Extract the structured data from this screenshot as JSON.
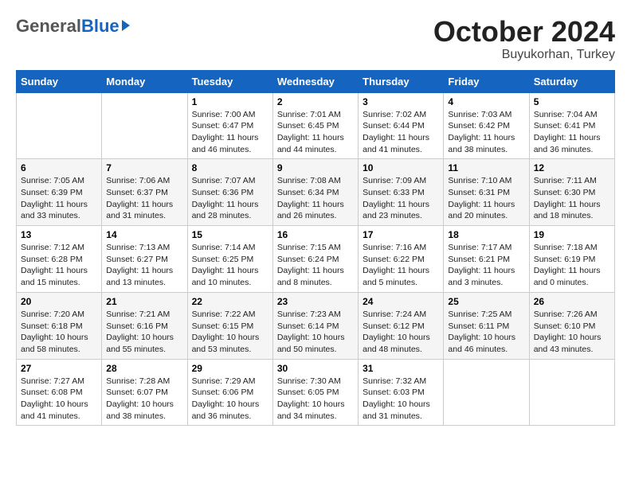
{
  "header": {
    "logo_general": "General",
    "logo_blue": "Blue",
    "month_title": "October 2024",
    "location": "Buyukorhan, Turkey"
  },
  "weekdays": [
    "Sunday",
    "Monday",
    "Tuesday",
    "Wednesday",
    "Thursday",
    "Friday",
    "Saturday"
  ],
  "weeks": [
    [
      null,
      null,
      {
        "day": 1,
        "sunrise": "7:00 AM",
        "sunset": "6:47 PM",
        "daylight": "11 hours and 46 minutes."
      },
      {
        "day": 2,
        "sunrise": "7:01 AM",
        "sunset": "6:45 PM",
        "daylight": "11 hours and 44 minutes."
      },
      {
        "day": 3,
        "sunrise": "7:02 AM",
        "sunset": "6:44 PM",
        "daylight": "11 hours and 41 minutes."
      },
      {
        "day": 4,
        "sunrise": "7:03 AM",
        "sunset": "6:42 PM",
        "daylight": "11 hours and 38 minutes."
      },
      {
        "day": 5,
        "sunrise": "7:04 AM",
        "sunset": "6:41 PM",
        "daylight": "11 hours and 36 minutes."
      }
    ],
    [
      {
        "day": 6,
        "sunrise": "7:05 AM",
        "sunset": "6:39 PM",
        "daylight": "11 hours and 33 minutes."
      },
      {
        "day": 7,
        "sunrise": "7:06 AM",
        "sunset": "6:37 PM",
        "daylight": "11 hours and 31 minutes."
      },
      {
        "day": 8,
        "sunrise": "7:07 AM",
        "sunset": "6:36 PM",
        "daylight": "11 hours and 28 minutes."
      },
      {
        "day": 9,
        "sunrise": "7:08 AM",
        "sunset": "6:34 PM",
        "daylight": "11 hours and 26 minutes."
      },
      {
        "day": 10,
        "sunrise": "7:09 AM",
        "sunset": "6:33 PM",
        "daylight": "11 hours and 23 minutes."
      },
      {
        "day": 11,
        "sunrise": "7:10 AM",
        "sunset": "6:31 PM",
        "daylight": "11 hours and 20 minutes."
      },
      {
        "day": 12,
        "sunrise": "7:11 AM",
        "sunset": "6:30 PM",
        "daylight": "11 hours and 18 minutes."
      }
    ],
    [
      {
        "day": 13,
        "sunrise": "7:12 AM",
        "sunset": "6:28 PM",
        "daylight": "11 hours and 15 minutes."
      },
      {
        "day": 14,
        "sunrise": "7:13 AM",
        "sunset": "6:27 PM",
        "daylight": "11 hours and 13 minutes."
      },
      {
        "day": 15,
        "sunrise": "7:14 AM",
        "sunset": "6:25 PM",
        "daylight": "11 hours and 10 minutes."
      },
      {
        "day": 16,
        "sunrise": "7:15 AM",
        "sunset": "6:24 PM",
        "daylight": "11 hours and 8 minutes."
      },
      {
        "day": 17,
        "sunrise": "7:16 AM",
        "sunset": "6:22 PM",
        "daylight": "11 hours and 5 minutes."
      },
      {
        "day": 18,
        "sunrise": "7:17 AM",
        "sunset": "6:21 PM",
        "daylight": "11 hours and 3 minutes."
      },
      {
        "day": 19,
        "sunrise": "7:18 AM",
        "sunset": "6:19 PM",
        "daylight": "11 hours and 0 minutes."
      }
    ],
    [
      {
        "day": 20,
        "sunrise": "7:20 AM",
        "sunset": "6:18 PM",
        "daylight": "10 hours and 58 minutes."
      },
      {
        "day": 21,
        "sunrise": "7:21 AM",
        "sunset": "6:16 PM",
        "daylight": "10 hours and 55 minutes."
      },
      {
        "day": 22,
        "sunrise": "7:22 AM",
        "sunset": "6:15 PM",
        "daylight": "10 hours and 53 minutes."
      },
      {
        "day": 23,
        "sunrise": "7:23 AM",
        "sunset": "6:14 PM",
        "daylight": "10 hours and 50 minutes."
      },
      {
        "day": 24,
        "sunrise": "7:24 AM",
        "sunset": "6:12 PM",
        "daylight": "10 hours and 48 minutes."
      },
      {
        "day": 25,
        "sunrise": "7:25 AM",
        "sunset": "6:11 PM",
        "daylight": "10 hours and 46 minutes."
      },
      {
        "day": 26,
        "sunrise": "7:26 AM",
        "sunset": "6:10 PM",
        "daylight": "10 hours and 43 minutes."
      }
    ],
    [
      {
        "day": 27,
        "sunrise": "7:27 AM",
        "sunset": "6:08 PM",
        "daylight": "10 hours and 41 minutes."
      },
      {
        "day": 28,
        "sunrise": "7:28 AM",
        "sunset": "6:07 PM",
        "daylight": "10 hours and 38 minutes."
      },
      {
        "day": 29,
        "sunrise": "7:29 AM",
        "sunset": "6:06 PM",
        "daylight": "10 hours and 36 minutes."
      },
      {
        "day": 30,
        "sunrise": "7:30 AM",
        "sunset": "6:05 PM",
        "daylight": "10 hours and 34 minutes."
      },
      {
        "day": 31,
        "sunrise": "7:32 AM",
        "sunset": "6:03 PM",
        "daylight": "10 hours and 31 minutes."
      },
      null,
      null
    ]
  ],
  "labels": {
    "sunrise_prefix": "Sunrise: ",
    "sunset_prefix": "Sunset: ",
    "daylight_prefix": "Daylight: "
  }
}
